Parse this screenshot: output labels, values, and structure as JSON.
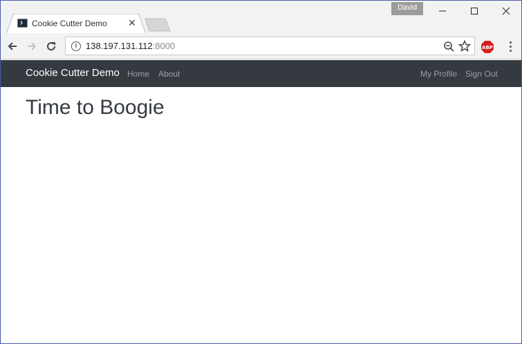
{
  "window": {
    "profile_name": "David",
    "tab": {
      "title": "Cookie Cutter Demo",
      "close_glyph": "✕"
    }
  },
  "toolbar": {
    "url_host": "138.197.131.112",
    "url_port": ":8000",
    "info_glyph": "i",
    "extension_label": "ABP"
  },
  "navbar": {
    "brand": "Cookie Cutter Demo",
    "links_left": [
      "Home",
      "About"
    ],
    "links_right": [
      "My Profile",
      "Sign Out"
    ]
  },
  "page": {
    "heading": "Time to Boogie"
  },
  "colors": {
    "navbar_bg": "#343a40",
    "nav_link": "#9aa0a6",
    "brand_text": "#ffffff",
    "heading_text": "#343a40",
    "window_border": "#4a5aa8"
  }
}
